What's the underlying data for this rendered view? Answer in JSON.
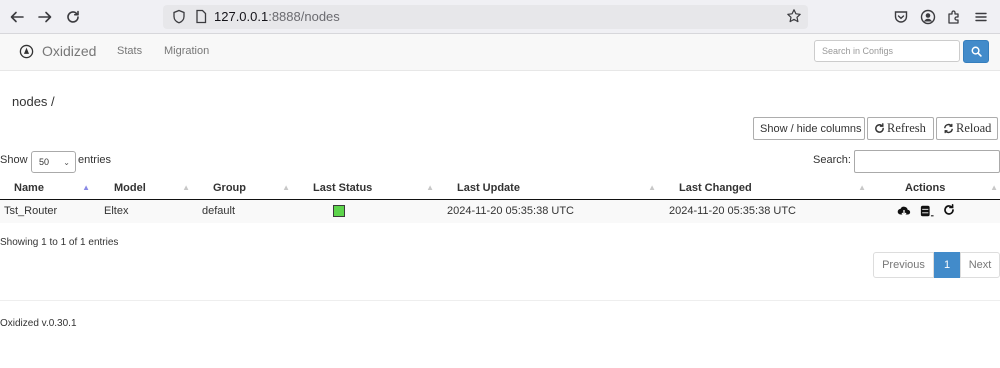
{
  "browser": {
    "url_host": "127.0.0.1",
    "url_rest": ":8888/nodes"
  },
  "navbar": {
    "brand": "Oxidized",
    "links": [
      "Stats",
      "Migration"
    ],
    "search_placeholder": "Search in Configs",
    "search_button_color": "#428bca"
  },
  "page": {
    "title": "nodes /"
  },
  "controls": {
    "show_hide_columns": "Show / hide columns",
    "refresh": "Refresh",
    "reload": "Reload",
    "show_label": "Show",
    "page_length": "50",
    "entries_label": "entries",
    "search_label": "Search:"
  },
  "table": {
    "columns": [
      "Name",
      "Model",
      "Group",
      "Last Status",
      "Last Update",
      "Last Changed",
      "Actions"
    ],
    "rows": [
      {
        "name": "Tst_Router",
        "model": "Eltex",
        "group": "default",
        "last_status_color": "#5dd44c",
        "last_update": "2024-11-20 05:35:38 UTC",
        "last_changed": "2024-11-20 05:35:38 UTC",
        "actions": [
          "cloud-download-icon",
          "database-icon",
          "refresh-icon"
        ]
      }
    ]
  },
  "info": "Showing 1 to 1 of 1 entries",
  "pagination": {
    "previous": "Previous",
    "current": "1",
    "next": "Next"
  },
  "footer": "Oxidized v.0.30.1"
}
